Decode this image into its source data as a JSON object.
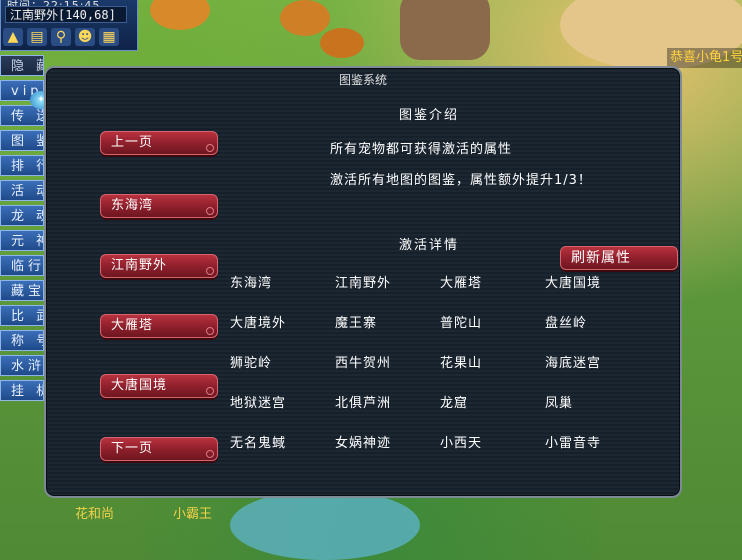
{
  "hud": {
    "time": "时间：22:15:45",
    "location": "江南野外[140,68]",
    "icons": [
      "team-icon",
      "map-icon",
      "search-icon",
      "friend-icon",
      "calendar-icon"
    ]
  },
  "announcement": "恭喜小龟1号",
  "left_menu": {
    "hide_label": "隐 藏",
    "vip_label": "vip",
    "items": [
      "传 送",
      "图 鉴",
      "排 行",
      "活 动",
      "龙 魂",
      "元 神",
      "临行要",
      "藏宝阁",
      "比 武",
      "称 号",
      "水浒传",
      "挂 机"
    ]
  },
  "dialog": {
    "title": "图鉴系统",
    "intro_title": "图鉴介绍",
    "intro_line1": "所有宠物都可获得激活的属性",
    "intro_line2": "激活所有地图的图鉴，属性额外提升1/3！",
    "detail_title": "激活详情",
    "refresh_label": "刷新属性",
    "prev_label": "上一页",
    "next_label": "下一页",
    "map_buttons": [
      "东海湾",
      "江南野外",
      "大雁塔",
      "大唐国境"
    ],
    "map_grid": [
      "东海湾",
      "江南野外",
      "大雁塔",
      "大唐国境",
      "大唐境外",
      "魔王寨",
      "普陀山",
      "盘丝岭",
      "狮驼岭",
      "西牛贺州",
      "花果山",
      "海底迷宫",
      "地狱迷宫",
      "北俱芦洲",
      "龙窟",
      "凤巢",
      "无名鬼蜮",
      "女娲神迹",
      "小西天",
      "小雷音寺"
    ]
  },
  "npcs": [
    "花和尚",
    "小霸王"
  ],
  "colors": {
    "button_red": "#8c1f2b",
    "npc_name": "#f2d24a",
    "announce": "#ffd23d"
  }
}
